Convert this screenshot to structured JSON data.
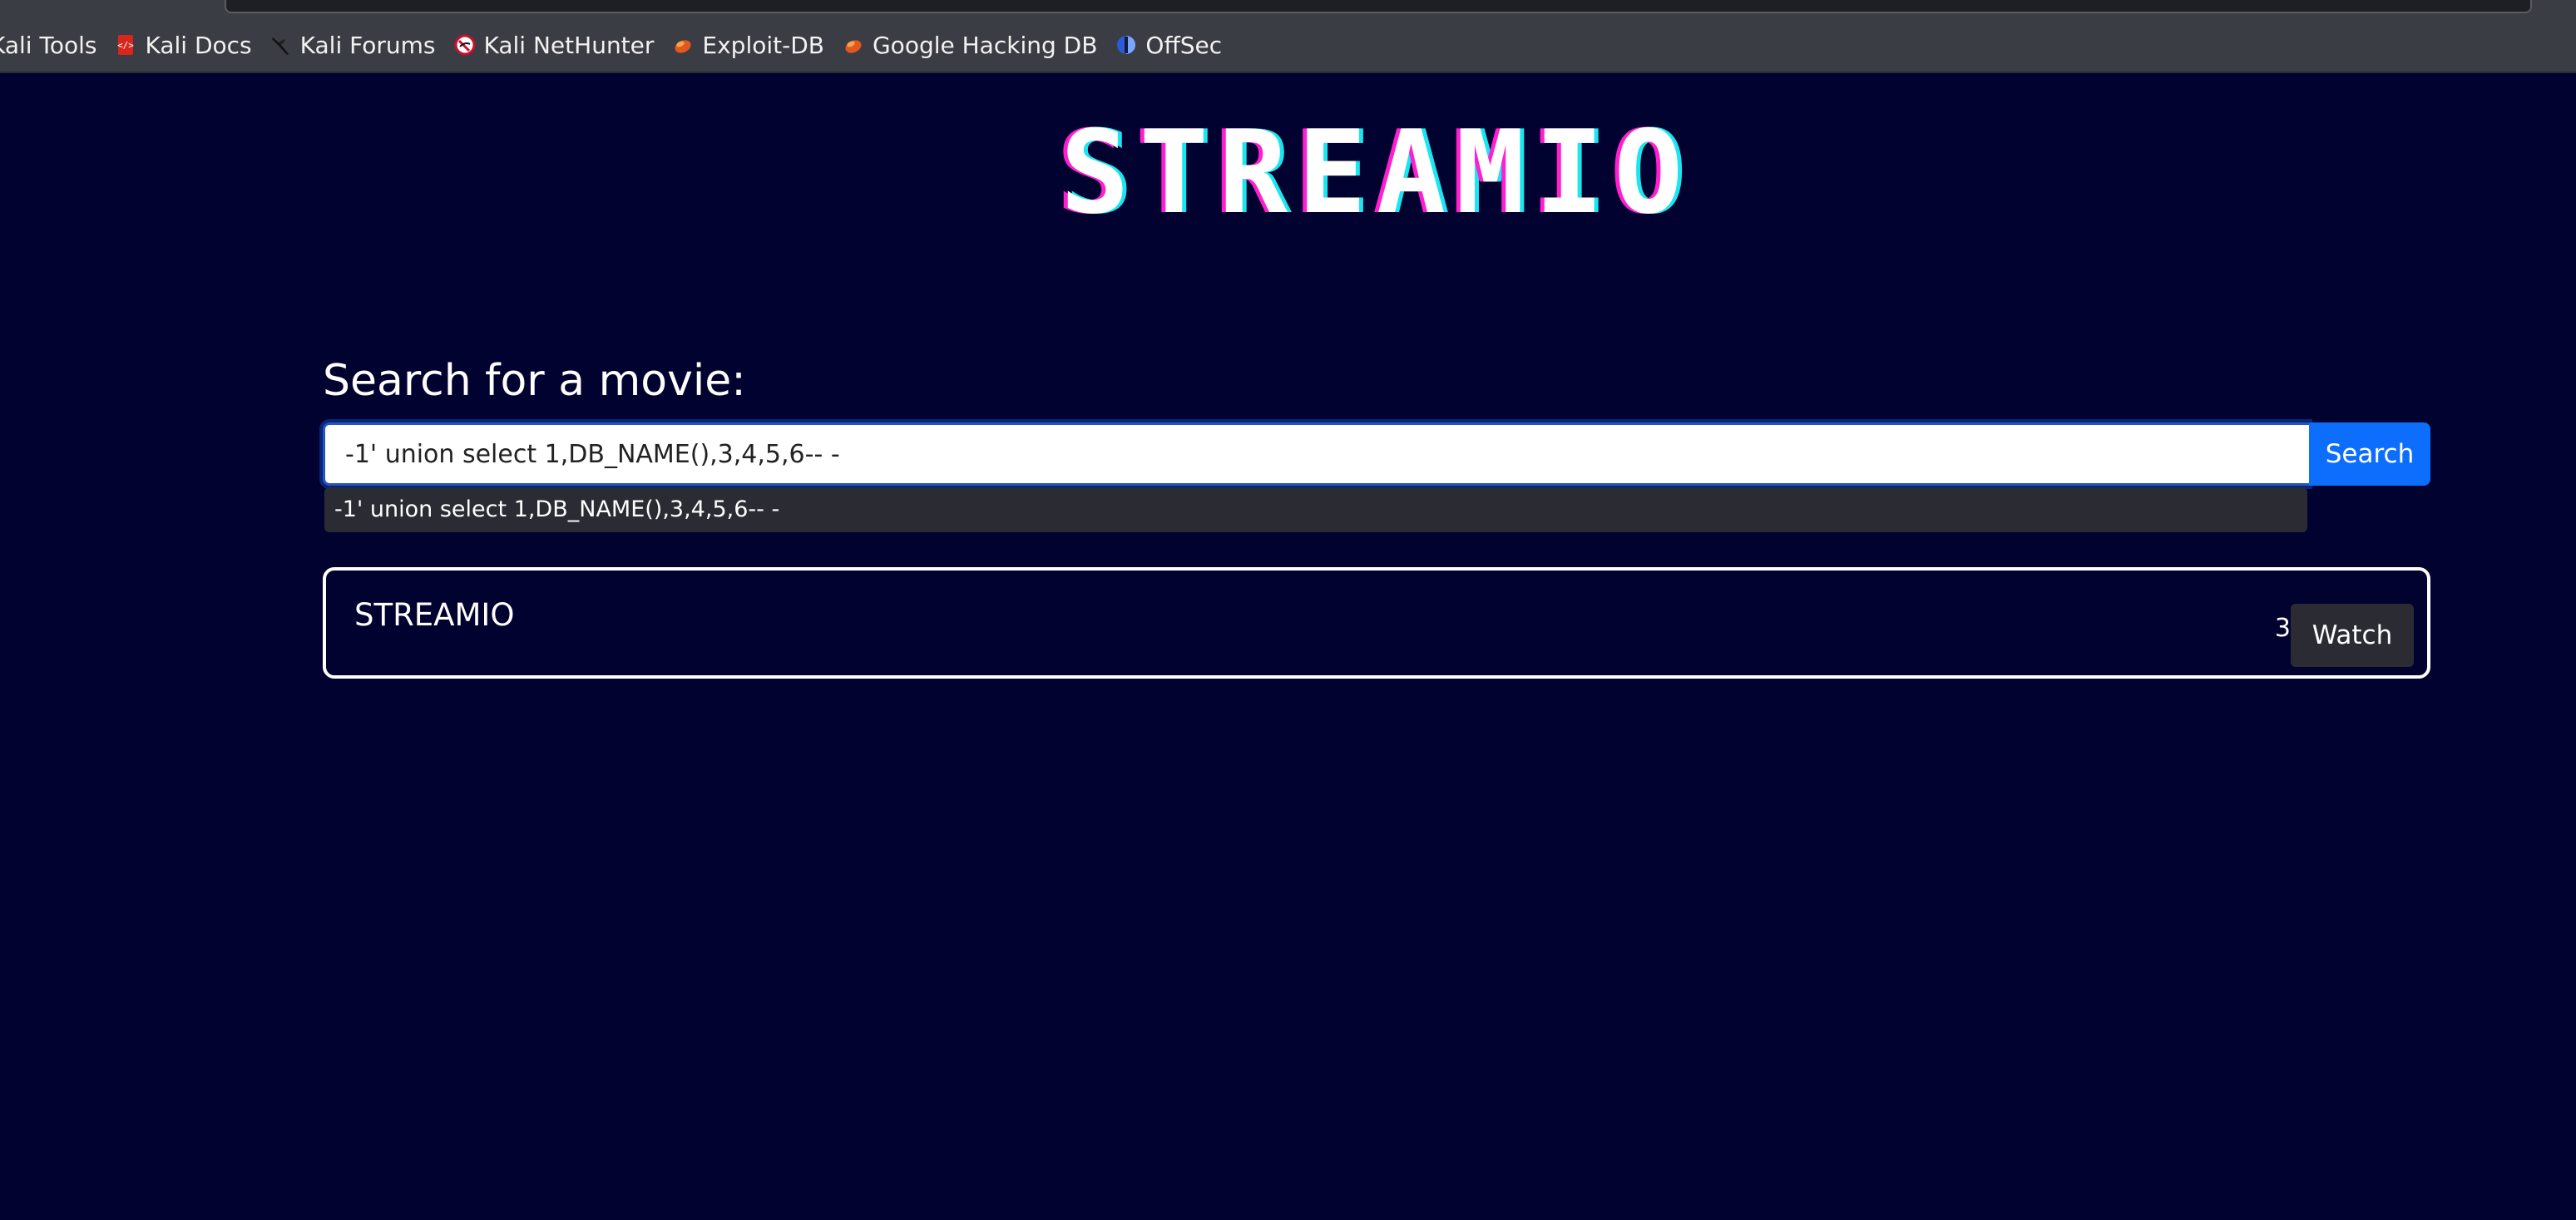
{
  "bookmarks": [
    {
      "label": "Kali Tools",
      "icon": "kali-tools-icon"
    },
    {
      "label": "Kali Docs",
      "icon": "kali-docs-icon"
    },
    {
      "label": "Kali Forums",
      "icon": "kali-forums-icon"
    },
    {
      "label": "Kali NetHunter",
      "icon": "kali-nethunter-icon"
    },
    {
      "label": "Exploit-DB",
      "icon": "exploit-db-icon"
    },
    {
      "label": "Google Hacking DB",
      "icon": "google-hacking-db-icon"
    },
    {
      "label": "OffSec",
      "icon": "offsec-icon"
    }
  ],
  "logo": {
    "text": "STREAMIO"
  },
  "search": {
    "heading": "Search for a movie:",
    "value": "-1' union select 1,DB_NAME(),3,4,5,6-- -",
    "button_label": "Search",
    "suggestion": "-1' union select 1,DB_NAME(),3,4,5,6-- -"
  },
  "result": {
    "title": "STREAMIO",
    "number": "3",
    "watch_label": "Watch"
  },
  "colors": {
    "background": "#020230",
    "accent": "#0d6efd",
    "logo_shadow_pink": "#ff1fd1",
    "logo_shadow_cyan": "#19e6f0"
  }
}
